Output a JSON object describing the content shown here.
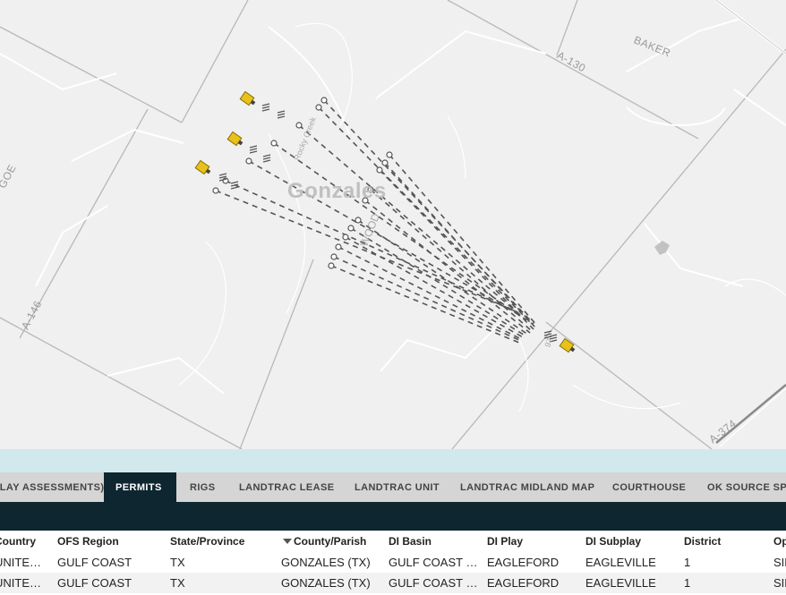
{
  "map": {
    "area_labels": [
      "GOE",
      "BAKER",
      "A-130",
      "A-146",
      "A-374"
    ],
    "county_label": "Gonzales",
    "street_labels": [
      "Rocky Creek",
      "WOOD",
      "97"
    ],
    "colors": {
      "background": "#f0f0f0",
      "boundary": "#b8b8b8",
      "road": "#ffffff",
      "well_path": "#555555",
      "well_marker": "#e8c21a"
    },
    "icons": [
      "well-pad-icon",
      "bottom-hole-icon"
    ]
  },
  "tabs": [
    {
      "label": "(PLAY ASSESSMENTS)",
      "active": false
    },
    {
      "label": "PERMITS",
      "active": true
    },
    {
      "label": "RIGS",
      "active": false
    },
    {
      "label": "LANDTRAC LEASE",
      "active": false
    },
    {
      "label": "LANDTRAC UNIT",
      "active": false
    },
    {
      "label": "LANDTRAC MIDLAND MAP",
      "active": false
    },
    {
      "label": "COURTHOUSE",
      "active": false
    },
    {
      "label": "OK SOURCE SPACING",
      "active": false
    }
  ],
  "table": {
    "sorted_column": "County/Parish",
    "sort_direction": "descending",
    "columns": [
      "Country",
      "OFS Region",
      "State/Province",
      "County/Parish",
      "DI Basin",
      "DI Play",
      "DI Subplay",
      "District",
      "Operator"
    ],
    "rows": [
      [
        "UNITED STATES",
        "GULF COAST",
        "TX",
        "GONZALES (TX)",
        "GULF COAST BASIN",
        "EAGLEFORD",
        "EAGLEVILLE",
        "1",
        "SILVERBOW"
      ],
      [
        "UNITED STATES",
        "GULF COAST",
        "TX",
        "GONZALES (TX)",
        "GULF COAST BASIN",
        "EAGLEFORD",
        "EAGLEVILLE",
        "1",
        "SILVERBOW"
      ]
    ]
  }
}
